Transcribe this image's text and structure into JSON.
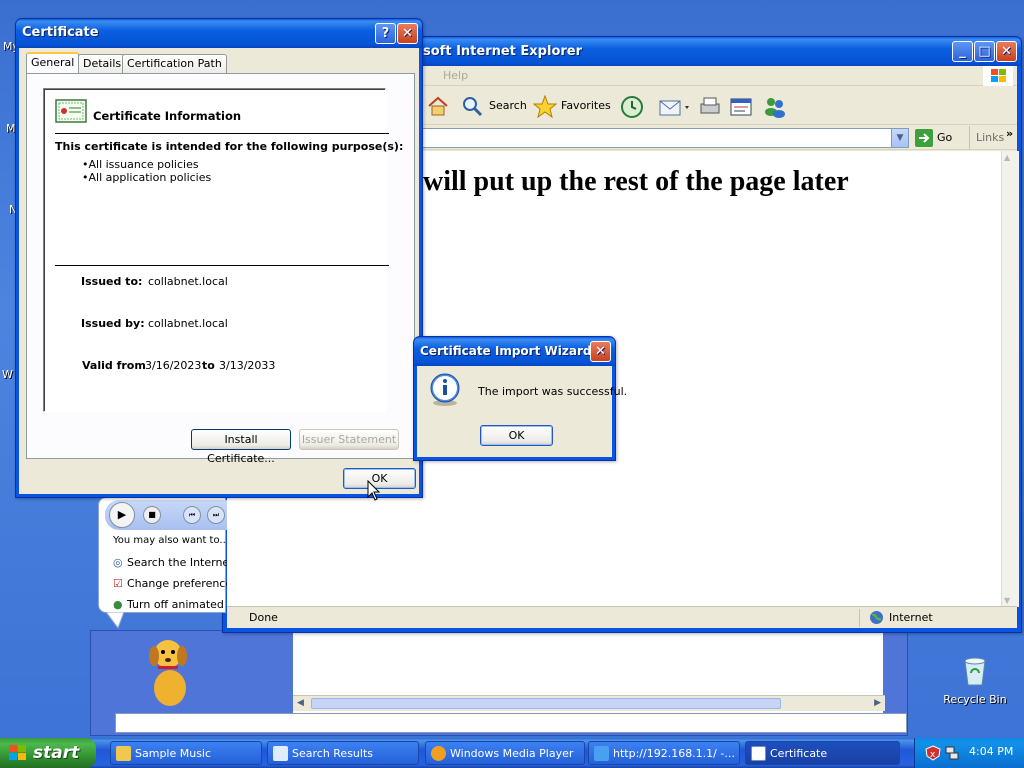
{
  "desktop": {
    "left_edge_labels": [
      "My",
      "M",
      "N",
      "W"
    ],
    "recycle_bin_label": "Recycle Bin"
  },
  "ie": {
    "title": "soft Internet Explorer",
    "menu_help": "Help",
    "toolbar": {
      "search": "Search",
      "favorites": "Favorites"
    },
    "address": {
      "go": "Go",
      "links": "Links"
    },
    "page_heading": "will put up the rest of the page later",
    "status_left": "Done",
    "status_zone": "Internet"
  },
  "assistant": {
    "prompt": "You may also want to...",
    "options": [
      "Search the Internet",
      "Change preferences",
      "Turn off animated character"
    ]
  },
  "certificate": {
    "title": "Certificate",
    "tabs": [
      "General",
      "Details",
      "Certification Path"
    ],
    "heading": "Certificate Information",
    "purpose_heading": "This certificate is intended for the following purpose(s):",
    "purposes": [
      "•All issuance policies",
      "•All application policies"
    ],
    "issued_to_label": "Issued to:",
    "issued_to": "collabnet.local",
    "issued_by_label": "Issued by:",
    "issued_by": "collabnet.local",
    "valid_from_label": "Valid from",
    "valid_from": "3/16/2023",
    "to_label": "to",
    "valid_to": "3/13/2033",
    "install_button": "Install Certificate...",
    "issuer_button": "Issuer Statement",
    "ok_button": "OK"
  },
  "wizard": {
    "title": "Certificate Import Wizard",
    "message": "The import was successful.",
    "ok_button": "OK"
  },
  "taskbar": {
    "start": "start",
    "items": [
      "Sample Music",
      "Search Results",
      "Windows Media Player",
      "http://192.168.1.1/ -...",
      "Certificate"
    ],
    "clock": "4:04 PM"
  },
  "colors": {
    "xp_blue": "#0a54e3",
    "dialog_bg": "#ece9d8",
    "start_green": "#3c9a3c"
  }
}
